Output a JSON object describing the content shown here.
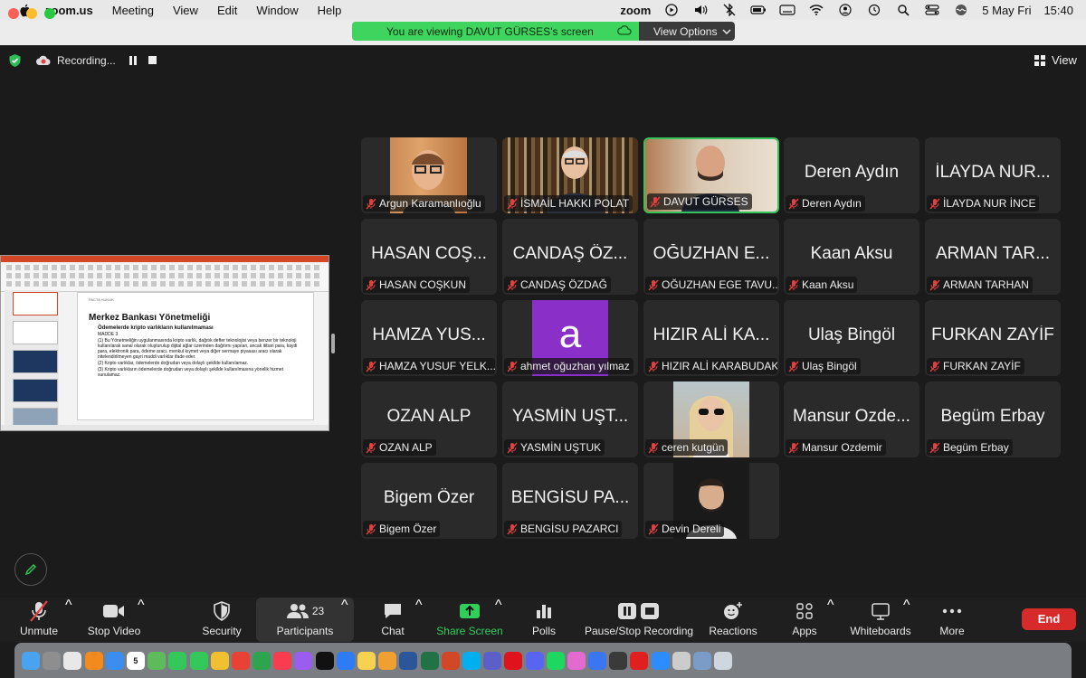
{
  "menubar": {
    "app_name": "zoom.us",
    "items": [
      "Meeting",
      "View",
      "Edit",
      "Window",
      "Help"
    ],
    "zoom_label": "zoom",
    "date": "5 May Fri",
    "time": "15:40"
  },
  "banner": {
    "viewing_text": "You are viewing DAVUT GÜRSES's screen",
    "view_options_label": "View Options"
  },
  "recording": {
    "status_text": "Recording...",
    "view_label": "View"
  },
  "shared_screen": {
    "firm_label": "PACTA HUKUK",
    "slide_title": "Merkez Bankası Yönetmeliği",
    "slide_subtitle": "Ödemelerde kripto varlıkların kullanılmaması",
    "slide_article": "MADDE 3",
    "slide_body": [
      "(1) Bu Yönetmeliğin uygulanmasında kripto varlık, dağıtık defter teknolojisi veya benzer bir teknoloji kullanılarak sanal olarak oluşturulup dijital ağlar üzerinden dağıtımı yapılan, ancak itibari para, kaydi para, elektronik para, ödeme aracı, menkul kıymet veya diğer sermaye piyasası aracı olarak nitelendirilmeyen gayri maddi varlıklar ifade eder.",
      "(2) Kripto varlıklar, ödemelerde doğrudan veya dolaylı şekilde kullanılamaz.",
      "(3) Kripto varlıkların ödemelerde doğrudan veya dolaylı şekilde kullanılmasına yönelik hizmet sunulamaz."
    ]
  },
  "participants": [
    {
      "tile_text": "",
      "name": "Argun Karamanlıoğlu",
      "photo": "man-glasses-orange"
    },
    {
      "tile_text": "",
      "name": "İSMAİL HAKKI POLAT",
      "photo": "man-bookshelf"
    },
    {
      "tile_text": "",
      "name": "DAVUT GÜRSES",
      "photo": "man-bald",
      "active": true
    },
    {
      "tile_text": "Deren Aydın",
      "name": "Deren Aydın"
    },
    {
      "tile_text": "İLAYDA NUR...",
      "name": "İLAYDA NUR İNCE"
    },
    {
      "tile_text": "HASAN COŞ...",
      "name": "HASAN COŞKUN"
    },
    {
      "tile_text": "CANDAŞ ÖZ...",
      "name": "CANDAŞ ÖZDAĞ"
    },
    {
      "tile_text": "OĞUZHAN E...",
      "name": "OĞUZHAN EGE TAVU..."
    },
    {
      "tile_text": "Kaan Aksu",
      "name": "Kaan Aksu"
    },
    {
      "tile_text": "ARMAN TAR...",
      "name": "ARMAN TARHAN"
    },
    {
      "tile_text": "HAMZA YUS...",
      "name": "HAMZA YUSUF YELK..."
    },
    {
      "tile_text": "a",
      "name": "ahmet oğuzhan yılmaz",
      "avatar_letter": "a"
    },
    {
      "tile_text": "HIZIR ALİ KA...",
      "name": "HIZIR ALİ KARABUDAK"
    },
    {
      "tile_text": "Ulaş Bingöl",
      "name": "Ulaş Bingöl"
    },
    {
      "tile_text": "FURKAN ZAYİF",
      "name": "FURKAN ZAYİF"
    },
    {
      "tile_text": "OZAN ALP",
      "name": "OZAN ALP"
    },
    {
      "tile_text": "YASMİN UŞT...",
      "name": "YASMİN UŞTUK"
    },
    {
      "tile_text": "",
      "name": "ceren kutgün",
      "photo": "woman-sunglasses"
    },
    {
      "tile_text": "Mansur Ozde...",
      "name": "Mansur Ozdemir"
    },
    {
      "tile_text": "Begüm Erbay",
      "name": "Begüm Erbay"
    },
    {
      "tile_text": "Bigem Özer",
      "name": "Bigem Özer"
    },
    {
      "tile_text": "BENGİSU PA...",
      "name": "BENGİSU PAZARCI"
    },
    {
      "tile_text": "",
      "name": "Devin Dereli",
      "photo": "man-dark-bg"
    }
  ],
  "toolbar": {
    "unmute": "Unmute",
    "stop_video": "Stop Video",
    "security": "Security",
    "participants": "Participants",
    "participant_count": "23",
    "chat": "Chat",
    "share_screen": "Share Screen",
    "polls": "Polls",
    "pause_stop_recording": "Pause/Stop Recording",
    "reactions": "Reactions",
    "apps": "Apps",
    "whiteboards": "Whiteboards",
    "more": "More",
    "end": "End"
  },
  "colors": {
    "accent_green": "#36c35a",
    "end_red": "#d72b2b",
    "avatar_purple": "#8b2fc9",
    "mute_red": "#e04040"
  },
  "dock": {
    "calendar_day": "5",
    "apps": [
      "finder",
      "launchpad",
      "safari",
      "firefox",
      "mail",
      "calendar",
      "maps",
      "messages",
      "facetime",
      "photos",
      "chrome",
      "numbers",
      "music",
      "podcasts",
      "tv",
      "app-store",
      "notes",
      "pages",
      "word",
      "excel",
      "powerpoint",
      "skype",
      "teams",
      "opera",
      "discord",
      "spotify",
      "shortcuts",
      "signal",
      "screen",
      "acrobat",
      "zoom",
      "recent",
      "downloads",
      "trash"
    ]
  }
}
